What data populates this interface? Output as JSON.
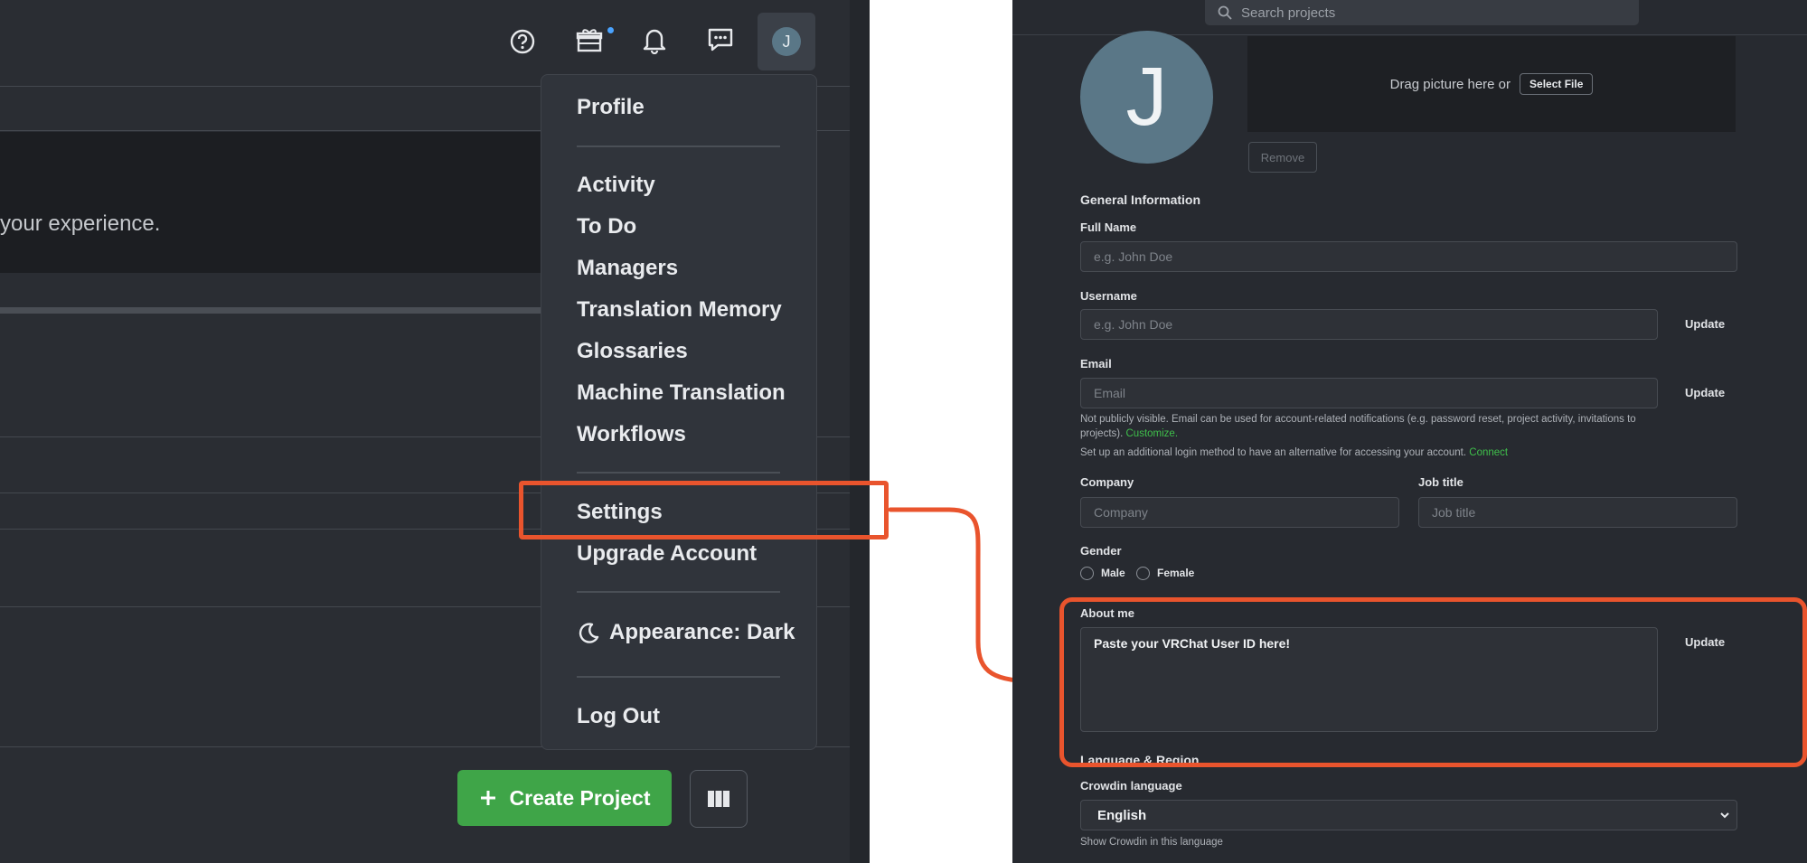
{
  "left": {
    "banner_text": "your experience.",
    "menu": {
      "profile": "Profile",
      "activity": "Activity",
      "todo": "To Do",
      "managers": "Managers",
      "translation_memory": "Translation Memory",
      "glossaries": "Glossaries",
      "machine_translation": "Machine Translation",
      "workflows": "Workflows",
      "settings": "Settings",
      "upgrade": "Upgrade Account",
      "appearance": "Appearance: Dark",
      "logout": "Log Out"
    },
    "avatar_initial": "J",
    "create_project": "Create Project"
  },
  "right": {
    "search_placeholder": "Search projects",
    "avatar_initial": "J",
    "drag_text": "Drag picture here or",
    "select_file": "Select File",
    "remove": "Remove",
    "general_info": "General Information",
    "full_name_label": "Full Name",
    "full_name_placeholder": "e.g. John Doe",
    "username_label": "Username",
    "username_placeholder": "e.g. John Doe",
    "email_label": "Email",
    "email_placeholder": "Email",
    "update": "Update",
    "email_note_1": "Not publicly visible. Email can be used for account-related notifications (e.g. password reset, project activity, invitations to projects).",
    "customize": "Customize.",
    "email_note_2": "Set up an additional login method to have an alternative for accessing your account.",
    "connect": "Connect",
    "company_label": "Company",
    "company_placeholder": "Company",
    "job_title_label": "Job title",
    "job_title_placeholder": "Job title",
    "gender_label": "Gender",
    "male": "Male",
    "female": "Female",
    "about_label": "About me",
    "about_value": "Paste your VRChat User ID here!",
    "lang_region": "Language & Region",
    "crowdin_lang_label": "Crowdin language",
    "crowdin_lang_value": "English",
    "crowdin_lang_note": "Show Crowdin in this language"
  },
  "colors": {
    "highlight": "#e9542d",
    "create_button": "#3fa548",
    "link_green": "#3fbf4b"
  }
}
